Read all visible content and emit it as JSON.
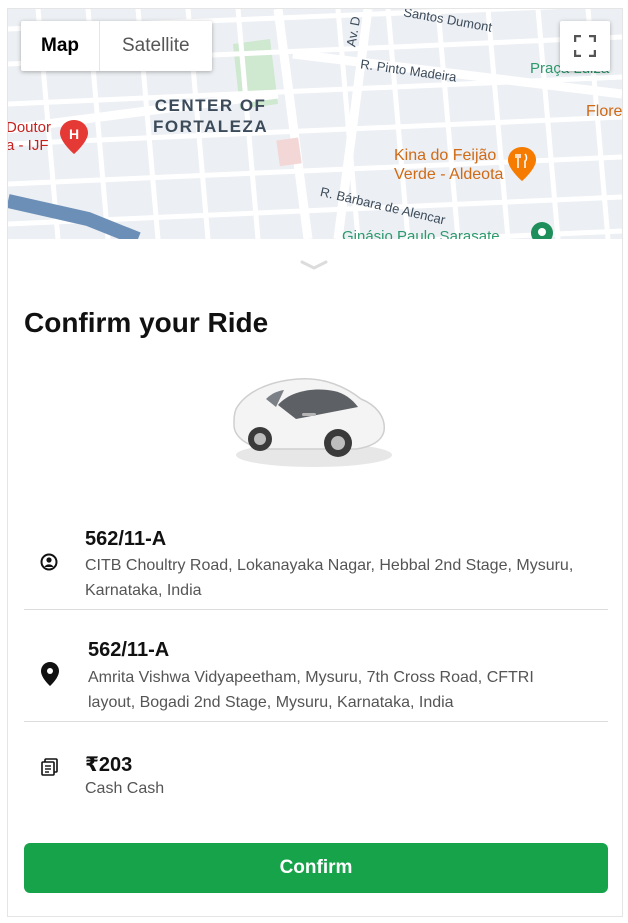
{
  "map": {
    "type_control": {
      "map_label": "Map",
      "satellite_label": "Satellite",
      "selected": "Map"
    },
    "labels": {
      "santos_dumont": "Santos Dumont",
      "av_d": "Av. D",
      "r_pinto_madeira": "R. Pinto Madeira",
      "praca_luiza": "Praça Luiza",
      "flore": "Flore",
      "center_of_fortaleza": "CENTER OF\nFORTALEZA",
      "doutor_ijf": "Doutor\na - IJF",
      "kina": "Kina do Feijão\nVerde - Aldeota",
      "r_barbara": "R. Bárbara de Alencar",
      "ginasio": "Ginásio Paulo Sarasate"
    },
    "colors": {
      "restaurant_marker": "#f57c00",
      "hospital_marker": "#e53935",
      "park_marker": "#1e8e5a",
      "street": "#ffffff",
      "block": "#e8eaed"
    }
  },
  "sheet": {
    "title": "Confirm your Ride",
    "pickup": {
      "icon": "pickup-location-icon",
      "name": "562/11-A",
      "address": "CITB Choultry Road, Lokanayaka Nagar, Hebbal 2nd Stage, Mysuru, Karnataka, India"
    },
    "destination": {
      "icon": "map-pin-icon",
      "name": "562/11-A",
      "address": "Amrita Vishwa Vidyapeetham, Mysuru, 7th Cross Road, CFTRI layout, Bogadi 2nd Stage, Mysuru, Karnataka, India"
    },
    "payment": {
      "icon": "cash-icon",
      "amount": "₹203",
      "method": "Cash Cash"
    },
    "confirm_label": "Confirm",
    "colors": {
      "confirm": "#16a34a"
    }
  }
}
